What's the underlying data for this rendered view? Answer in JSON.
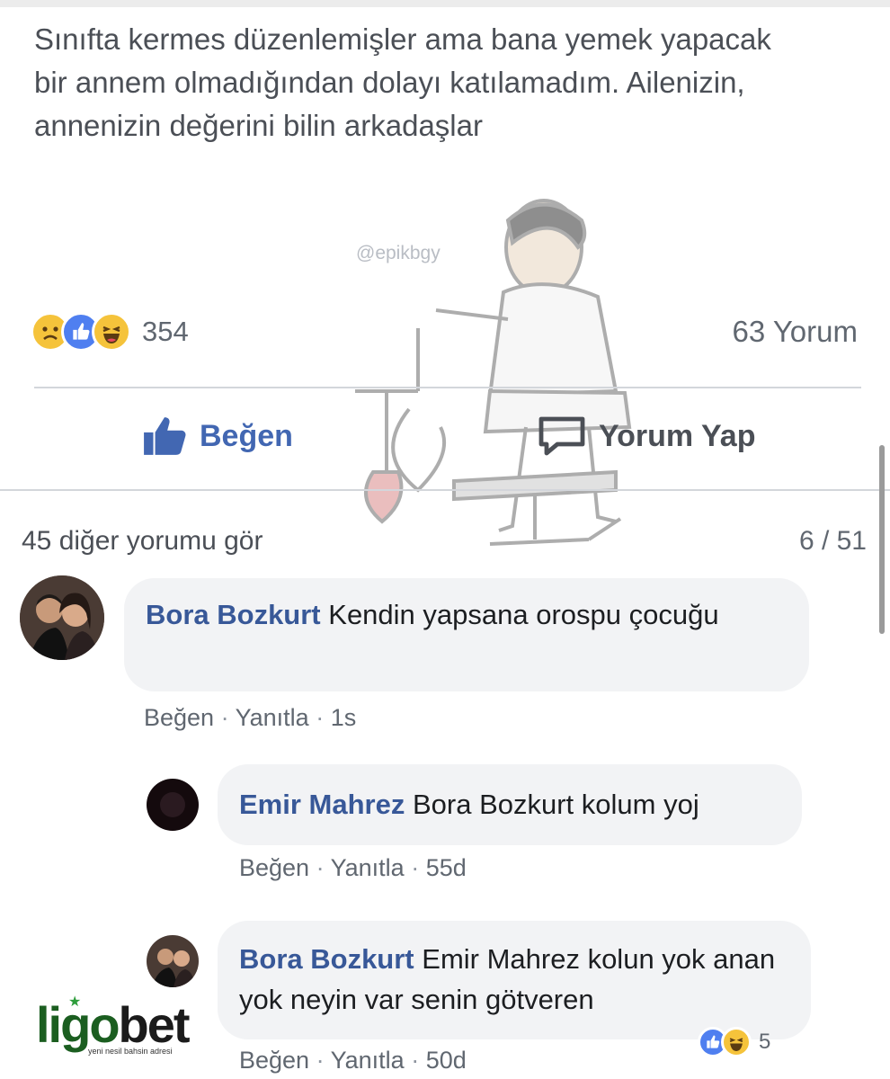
{
  "post": {
    "text": "Sınıfta kermes düzenlemişler ama bana yemek yapacak bir annem olmadığından dolayı katılamadım. Ailenizin, annenizin değerini bilin arkadaşlar",
    "watermark": "@epikbgy",
    "reaction_count": "354",
    "comment_count": "63 Yorum",
    "reaction_icons": [
      "sad-reaction-icon",
      "like-reaction-icon",
      "haha-reaction-icon"
    ]
  },
  "actions": {
    "like_label": "Beğen",
    "comment_label": "Yorum Yap"
  },
  "comments_header": {
    "more_label": "45 diğer yorumu gör",
    "pager": "6 / 51"
  },
  "comments": [
    {
      "author": "Bora Bozkurt",
      "text": "Kendin yapsana orospu çocuğu",
      "like": "Beğen",
      "reply": "Yanıtla",
      "time": "1s"
    },
    {
      "author": "Emir Mahrez",
      "text": "Bora Bozkurt kolum yoj",
      "like": "Beğen",
      "reply": "Yanıtla",
      "time": "55d"
    },
    {
      "author": "Bora Bozkurt",
      "text": "Emir Mahrez kolun yok anan yok neyin var senin götveren",
      "like": "Beğen",
      "reply": "Yanıtla",
      "time": "50d",
      "reaction_count": "5"
    }
  ],
  "brand": {
    "logo_a": "ligo",
    "logo_b": "bet",
    "tagline": "yeni nesil bahsin adresi"
  },
  "colors": {
    "facebook_blue": "#4267b2",
    "name_blue": "#385898",
    "text_gray": "#4b4f56",
    "bubble_gray": "#f2f3f5",
    "brand_green": "#1b5e20"
  }
}
